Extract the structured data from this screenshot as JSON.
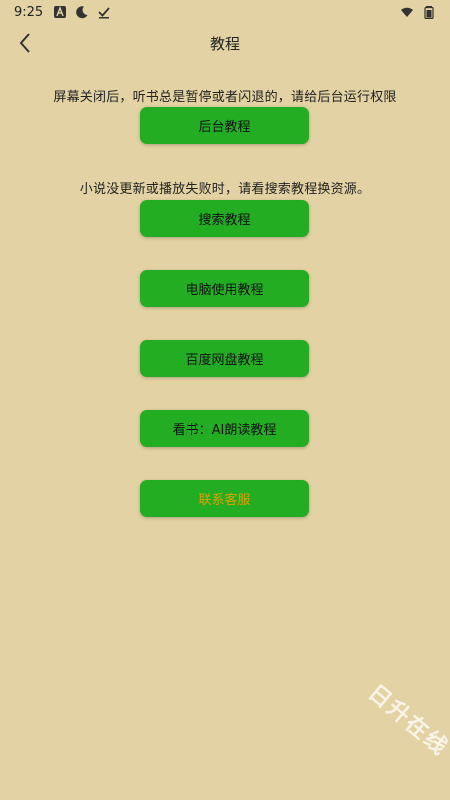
{
  "status_bar": {
    "time": "9:25",
    "icons_left": [
      "font-a-icon",
      "moon-icon",
      "checkmark-icon"
    ],
    "icons_right": [
      "wifi-icon",
      "battery-icon"
    ]
  },
  "header": {
    "title": "教程",
    "back_icon": "chevron-left-icon"
  },
  "sections": {
    "background_note": "屏幕关闭后，听书总是暂停或者闪退的，请给后台运行权限",
    "search_note": "小说没更新或播放失败时，请看搜索教程换资源。"
  },
  "buttons": {
    "background": "后台教程",
    "search": "搜索教程",
    "computer": "电脑使用教程",
    "baidu": "百度网盘教程",
    "ai_read": "看书：AI朗读教程",
    "contact": "联系客服"
  },
  "colors": {
    "background": "#e3d2a3",
    "button": "#22ad22",
    "contact_text": "#e0a000"
  },
  "watermark": "日升在线"
}
